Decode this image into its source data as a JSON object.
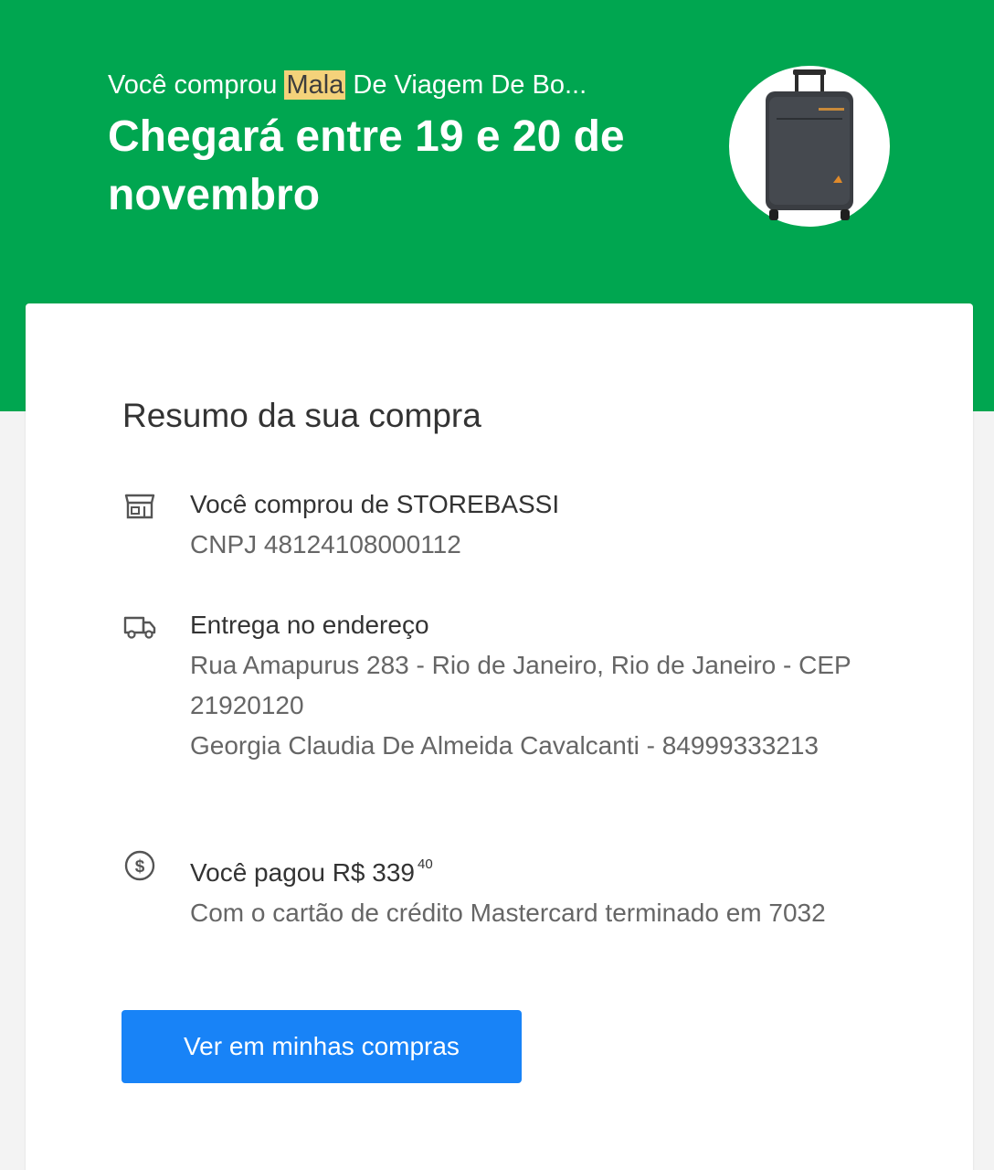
{
  "header": {
    "purchased_prefix": "Você comprou",
    "purchased_highlight": "Mala",
    "purchased_rest": "De Viagem De Bo...",
    "title": "Chegará entre 19 e 20 de novembro",
    "bg_color": "#00a650"
  },
  "summary": {
    "title": "Resumo da sua compra",
    "seller": {
      "icon": "store-icon",
      "line1": "Você comprou de STOREBASSI",
      "line2": "CNPJ 48124108000112"
    },
    "delivery": {
      "icon": "truck-icon",
      "line1": "Entrega no endereço",
      "address": "Rua Amapurus 283 - Rio de Janeiro, Rio de Janeiro - CEP 21920120",
      "recipient": "Georgia Claudia De Almeida Cavalcanti - 84999333213"
    },
    "payment": {
      "icon": "dollar-circle-icon",
      "label": "Você pagou R$ 339",
      "cents": "40",
      "detail": "Com o cartão de crédito Mastercard terminado em 7032"
    },
    "button_label": "Ver em minhas compras",
    "button_color": "#1883f7"
  }
}
